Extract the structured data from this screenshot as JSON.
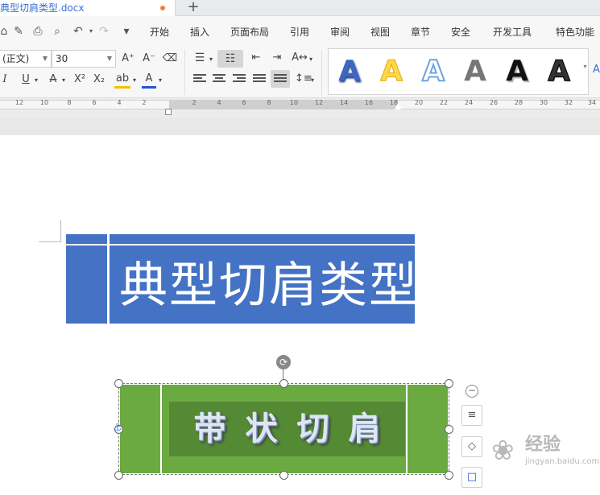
{
  "document_tab": {
    "title": "典型切肩类型.docx",
    "new_tab": "+"
  },
  "quick_access": {
    "home_icon": "⌂",
    "undo_icon": "↶",
    "redo_icon": "↷",
    "customize_icon": "▾"
  },
  "menu": [
    "开始",
    "插入",
    "页面布局",
    "引用",
    "审阅",
    "视图",
    "章节",
    "安全",
    "开发工具",
    "特色功能"
  ],
  "ribbon": {
    "font_name": "(正文)",
    "font_size": "30",
    "grow_font": "A⁺",
    "shrink_font": "A⁻",
    "clear_format": "⌫",
    "italic": "I",
    "underline": "U",
    "strike": "A",
    "superscript": "X²",
    "subscript": "X₂",
    "highlight": "ab",
    "font_color": "A",
    "highlight_color": "#f2c200",
    "font_color_value": "#2b4fd6",
    "text_styles": [
      "A",
      "A",
      "A",
      "A",
      "A",
      "A"
    ]
  },
  "ruler": {
    "labels": [
      "12",
      "10",
      "8",
      "6",
      "4",
      "2",
      "",
      "2",
      "4",
      "6",
      "8",
      "10",
      "12",
      "14",
      "16",
      "18",
      "20",
      "22",
      "24",
      "26",
      "28",
      "30",
      "32",
      "34"
    ]
  },
  "document": {
    "header_title": "典型切肩类型",
    "header_color": "#4472c4",
    "textbox_title": "带状切肩",
    "textbox_color": "#6aaa41",
    "textbox_inner_color": "#558a35"
  },
  "float_toolbar": {
    "collapse": "−",
    "layout_icon": "≡",
    "fill_icon": "◇",
    "border_icon": "□"
  },
  "watermark": {
    "logo": "❀",
    "text": "经验",
    "url": "jingyan.baidu.com"
  }
}
